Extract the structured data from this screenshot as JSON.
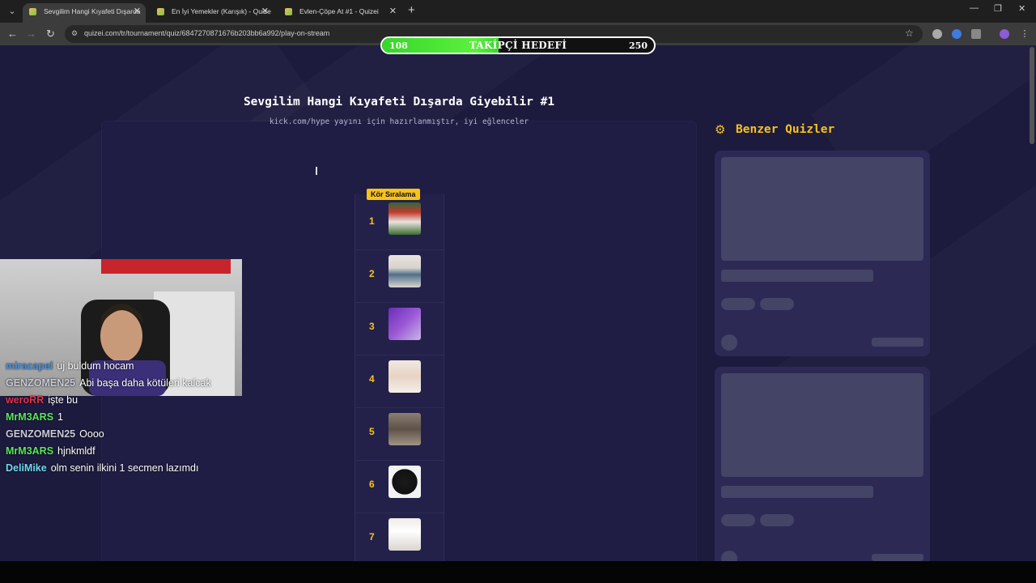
{
  "browser": {
    "tabs": [
      {
        "title": "Sevgilim Hangi Kıyafeti Dışarda",
        "active": true
      },
      {
        "title": "En İyi Yemekler (Karışık) - Quize",
        "active": false
      },
      {
        "title": "Evlen-Çöpe At #1 - Quizei",
        "active": false
      }
    ],
    "url": "quizei.com/tr/tournament/quiz/6847270871676b203bb6a992/play-on-stream"
  },
  "goal": {
    "current": "108",
    "label": "TAKİPÇİ HEDEFİ",
    "target": "250",
    "progress": 0.43
  },
  "quiz": {
    "title": "Sevgilim Hangi Kıyafeti Dışarda Giyebilir #1",
    "subtitle": "kick.com/hype yayını için hazırlanmıştır, iyi eğlenceler",
    "badge": "Kör Sıralama",
    "ranks": [
      "1",
      "2",
      "3",
      "4",
      "5",
      "6",
      "7"
    ]
  },
  "similar": {
    "title": "Benzer Quizler"
  },
  "chat": [
    {
      "user": "miracapel",
      "message": "uj buldum hocam",
      "color": "#4a8fd9"
    },
    {
      "user": "GENZOMEN25",
      "message": "Abi başa daha kötüleri kalcak",
      "color": "#c9c9d9"
    },
    {
      "user": "weroRR",
      "message": "işte bu",
      "color": "#e0334a"
    },
    {
      "user": "MrM3ARS",
      "message": "1",
      "color": "#5ce65c"
    },
    {
      "user": "GENZOMEN25",
      "message": "Oooo",
      "color": "#c9c9d9"
    },
    {
      "user": "MrM3ARS",
      "message": "hjnkmldf",
      "color": "#5ce65c"
    },
    {
      "user": "DeliMike",
      "message": "olm senin ilkini 1 secmen lazımdı",
      "color": "#6fd8f0"
    }
  ]
}
